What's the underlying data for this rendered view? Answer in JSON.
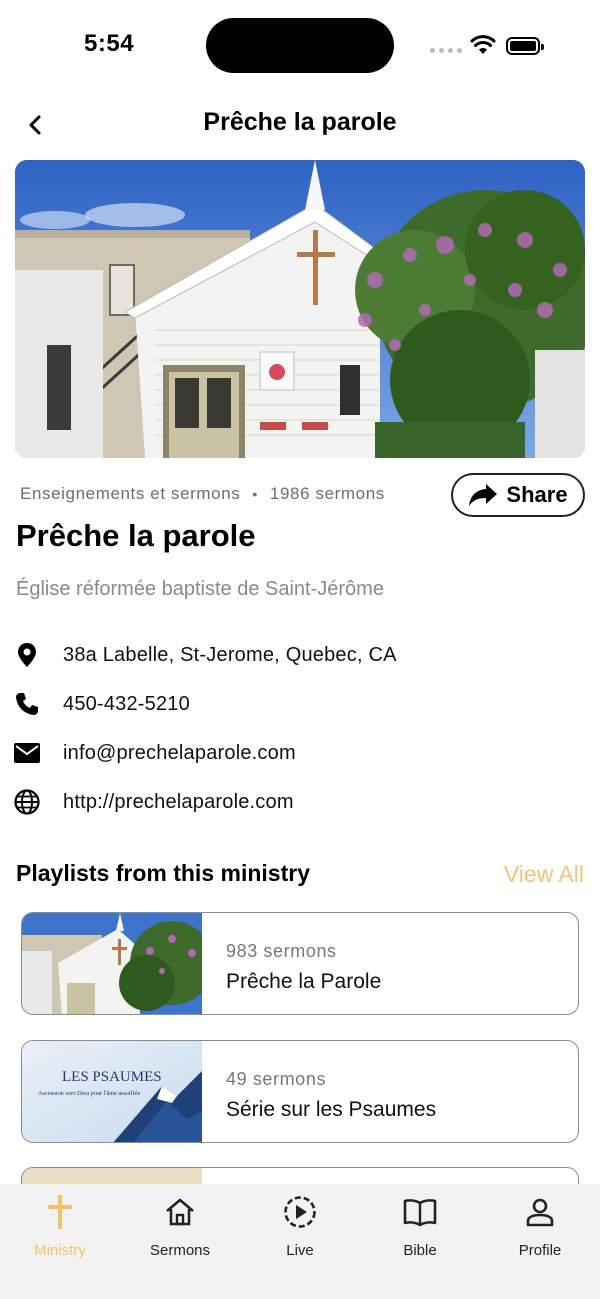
{
  "status_bar": {
    "time": "5:54"
  },
  "header": {
    "title": "Prêche la parole"
  },
  "meta": {
    "category": "Enseignements et sermons",
    "separator": "•",
    "sermon_count": "1986 sermons"
  },
  "share": {
    "label": "Share"
  },
  "ministry": {
    "title": "Prêche la parole",
    "subtitle": "Église réformée baptiste de Saint-Jérôme"
  },
  "contact": {
    "address": "38a Labelle, St-Jerome, Quebec, CA",
    "phone": "450-432-5210",
    "email": "info@prechelaparole.com",
    "website": "http://prechelaparole.com"
  },
  "playlists_section": {
    "title": "Playlists from this ministry",
    "view_all": "View All",
    "items": [
      {
        "count": "983 sermons",
        "name": "Prêche la Parole"
      },
      {
        "count": "49 sermons",
        "name": "Série sur les Psaumes",
        "thumb_title": "LES PSAUMES",
        "thumb_subtitle": "Ascension vers Dieu pour l'âme assoiffée"
      }
    ]
  },
  "tab_bar": {
    "tabs": [
      {
        "label": "Ministry",
        "icon": "cross-icon",
        "active": true
      },
      {
        "label": "Sermons",
        "icon": "home-icon"
      },
      {
        "label": "Live",
        "icon": "play-circle-icon"
      },
      {
        "label": "Bible",
        "icon": "book-icon"
      },
      {
        "label": "Profile",
        "icon": "person-icon"
      }
    ]
  },
  "colors": {
    "accent": "#f5c26b",
    "view_all": "#f2c47a",
    "muted_text": "#8a8a8a"
  }
}
